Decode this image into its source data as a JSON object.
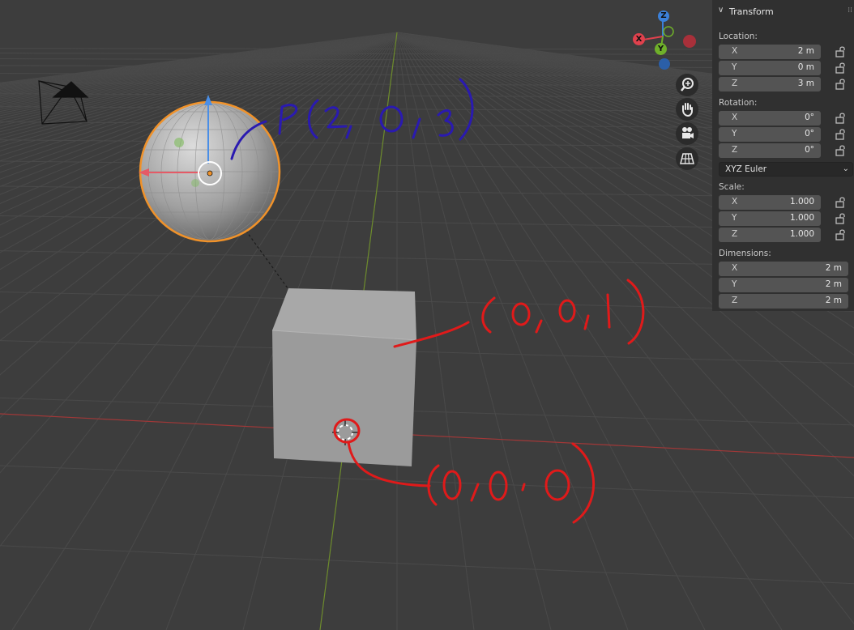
{
  "panel": {
    "title": "Transform",
    "location": {
      "label": "Location:",
      "x_label": "X",
      "x": "2 m",
      "y_label": "Y",
      "y": "0 m",
      "z_label": "Z",
      "z": "3 m"
    },
    "rotation": {
      "label": "Rotation:",
      "x_label": "X",
      "x": "0°",
      "y_label": "Y",
      "y": "0°",
      "z_label": "Z",
      "z": "0°",
      "mode": "XYZ Euler"
    },
    "scale": {
      "label": "Scale:",
      "x_label": "X",
      "x": "1.000",
      "y_label": "Y",
      "y": "1.000",
      "z_label": "Z",
      "z": "1.000"
    },
    "dimensions": {
      "label": "Dimensions:",
      "x_label": "X",
      "x": "2 m",
      "y_label": "Y",
      "y": "2 m",
      "z_label": "Z",
      "z": "2 m"
    }
  },
  "gizmo": {
    "z": "Z",
    "x": "X",
    "y": "Y",
    "x_color": "#e0414d",
    "y_color": "#6fb02a",
    "z_color": "#3b80d9"
  },
  "nav_tools": [
    "zoom-icon",
    "hand-icon",
    "camera-icon",
    "grid-icon"
  ],
  "colors": {
    "selection": "#f0922a",
    "x_axis_line": "#a13838",
    "y_axis_line": "#6d8b2c",
    "annotation_blue": "#2a1ab0",
    "annotation_red": "#e01a1a"
  }
}
